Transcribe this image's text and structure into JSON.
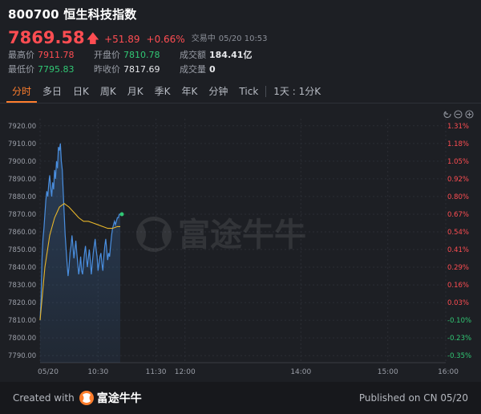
{
  "header": {
    "code": "800700",
    "name": "恒生科技指数",
    "price": "7869.58",
    "change": "+51.89",
    "change_pct": "+0.66%",
    "status": "交易中",
    "time": "05/20 10:53",
    "stats": {
      "high_label": "最高价",
      "high": "7911.78",
      "open_label": "开盘价",
      "open": "7810.78",
      "turnover_label": "成交额",
      "turnover": "184.41亿",
      "low_label": "最低价",
      "low": "7795.83",
      "prev_close_label": "昨收价",
      "prev_close": "7817.69",
      "volume_label": "成交量",
      "volume": "0"
    }
  },
  "tabs": [
    {
      "label": "分时",
      "active": true
    },
    {
      "label": "多日"
    },
    {
      "label": "日K"
    },
    {
      "label": "周K"
    },
    {
      "label": "月K"
    },
    {
      "label": "季K"
    },
    {
      "label": "年K"
    },
    {
      "label": "分钟"
    },
    {
      "label": "Tick"
    },
    {
      "label": "1天 : 1分K"
    }
  ],
  "watermark": "富途牛牛",
  "colors": {
    "up": "#ff4d52",
    "down": "#31c774",
    "accent": "#ff7e2d",
    "price_line": "#4a8fe0",
    "avg_line": "#e8b62a",
    "background": "#1d1f24"
  },
  "chart_data": {
    "type": "line",
    "y_ticks": [
      "7920.00",
      "7910.00",
      "7900.00",
      "7890.00",
      "7880.00",
      "7870.00",
      "7860.00",
      "7850.00",
      "7840.00",
      "7830.00",
      "7820.00",
      "7810.00",
      "7800.00",
      "7790.00"
    ],
    "pct_ticks": [
      "1.31%",
      "1.18%",
      "1.05%",
      "0.92%",
      "0.80%",
      "0.67%",
      "0.54%",
      "0.41%",
      "0.29%",
      "0.16%",
      "0.03%",
      "-0.10%",
      "-0.23%",
      "-0.35%"
    ],
    "ylim": [
      7786,
      7924
    ],
    "x_ticks": [
      "05/20",
      "10:30",
      "11:30",
      "12:00",
      "14:00",
      "15:00",
      "16:00"
    ],
    "session_end_minute": 420,
    "x_tick_minutes": [
      0,
      60,
      120,
      150,
      270,
      360,
      420
    ],
    "reference_price": 7817.69,
    "series": [
      {
        "x": [
          0,
          1,
          2,
          3,
          4,
          5,
          6,
          7,
          8,
          9,
          10,
          11,
          12,
          13,
          14,
          15,
          16,
          17,
          18,
          19,
          20,
          21,
          22,
          23,
          24,
          25,
          26,
          27,
          28,
          29,
          30,
          31,
          32,
          33,
          34,
          35,
          36,
          37,
          38,
          39,
          40,
          41,
          42,
          43,
          44,
          45,
          46,
          47,
          48,
          49,
          50,
          51,
          52,
          53,
          54,
          55,
          56,
          57,
          58,
          59,
          60,
          61,
          62,
          63,
          64,
          65,
          66,
          67,
          68,
          69,
          70,
          71,
          72,
          73,
          74,
          75,
          76,
          77,
          78,
          79,
          80,
          81,
          82,
          83
        ],
        "values": [
          7810,
          7822,
          7845,
          7856,
          7862,
          7870,
          7878,
          7883,
          7880,
          7887,
          7892,
          7885,
          7880,
          7888,
          7884,
          7895,
          7890,
          7900,
          7896,
          7908,
          7906,
          7910,
          7900,
          7895,
          7882,
          7870,
          7858,
          7850,
          7842,
          7835,
          7840,
          7848,
          7852,
          7858,
          7852,
          7845,
          7850,
          7855,
          7848,
          7842,
          7836,
          7840,
          7846,
          7838,
          7836,
          7842,
          7848,
          7852,
          7846,
          7840,
          7845,
          7850,
          7844,
          7836,
          7842,
          7848,
          7852,
          7856,
          7850,
          7846,
          7838,
          7842,
          7846,
          7848,
          7842,
          7838,
          7846,
          7852,
          7856,
          7850,
          7844,
          7848,
          7846,
          7852,
          7858,
          7862,
          7864,
          7866,
          7864,
          7866,
          7868,
          7868,
          7870,
          7870
        ]
      },
      {
        "x": [
          0,
          5,
          10,
          15,
          20,
          25,
          30,
          35,
          40,
          45,
          50,
          55,
          60,
          65,
          70,
          75,
          80,
          83
        ],
        "values": [
          7810,
          7840,
          7858,
          7868,
          7874,
          7876,
          7874,
          7871,
          7868,
          7866,
          7866,
          7865,
          7864,
          7863,
          7862,
          7862,
          7863,
          7863
        ]
      }
    ],
    "grid": true
  },
  "footer": {
    "created_with": "Created with",
    "brand": "富途牛牛",
    "published": "Published on CN 05/20"
  }
}
